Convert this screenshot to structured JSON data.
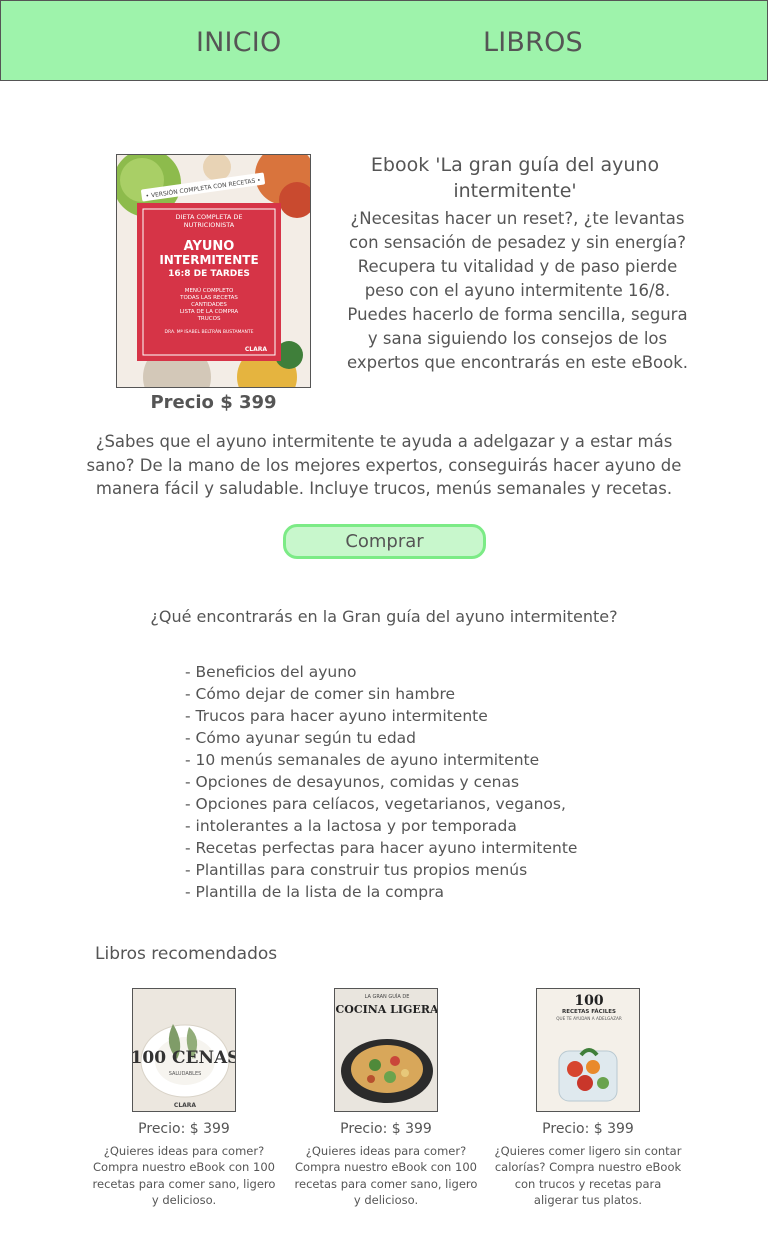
{
  "nav": {
    "inicio": "INICIO",
    "libros": "LIBROS"
  },
  "hero": {
    "cover": {
      "badge": "• VERSIÓN COMPLETA CON RECETAS •",
      "line1": "DIETA COMPLETA DE",
      "line2": "NUTRICIONISTA",
      "title1": "AYUNO",
      "title2": "INTERMITENTE",
      "title3": "16:8 DE TARDES",
      "items": [
        "MENÚ COMPLETO",
        "TODAS LAS RECETAS",
        "CANTIDADES",
        "LISTA DE LA COMPRA",
        "TRUCOS"
      ],
      "author": "DRA. Mª ISABEL BELTRÁN BUSTAMANTE",
      "publisher": "CLARA"
    },
    "price": "Precio $ 399",
    "title": "Ebook 'La gran guía del ayuno intermitente'",
    "description": "¿Necesitas hacer un reset?, ¿te levantas con sensación de pesadez y sin energía? Recupera tu vitalidad y de paso pierde peso con el ayuno intermitente 16/8. Puedes hacerlo de forma sencilla, segura y sana siguiendo los consejos de los expertos que encontrarás en este eBook."
  },
  "intro": "¿Sabes que el ayuno intermitente te ayuda a adelgazar y a estar más sano? De la mano de los mejores expertos, conseguirás hacer ayuno de manera fácil y saludable. Incluye trucos, menús semanales y recetas.",
  "buy_button": "Comprar",
  "features_title": "¿Qué encontrarás en la Gran guía del ayuno intermitente?",
  "features": [
    "- Beneficios del ayuno",
    "- Cómo dejar de comer sin hambre",
    "- Trucos para hacer ayuno intermitente",
    "- Cómo ayunar según tu edad",
    "- 10 menús semanales de ayuno intermitente",
    "- Opciones de desayunos, comidas y cenas",
    "- Opciones para celíacos, vegetarianos, veganos,",
    "- intolerantes a la lactosa y por temporada",
    "- Recetas perfectas para hacer ayuno intermitente",
    "- Plantillas para construir tus propios menús",
    "- Plantilla de la lista de la compra"
  ],
  "recommended_title": "Libros recomendados",
  "recommended": [
    {
      "cover_text": "100 CENAS",
      "cover_sub": "SALUDABLES",
      "cover_publisher": "CLARA",
      "price": "Precio: $ 399",
      "description": "¿Quieres ideas para comer? Compra nuestro eBook con 100 recetas para comer sano, ligero y delicioso."
    },
    {
      "cover_text": "COCINA LIGERA",
      "cover_sub": "LA GRAN GUÍA DE",
      "price": "Precio: $ 399",
      "description": "¿Quieres ideas para comer? Compra nuestro eBook con 100 recetas para comer sano, ligero y delicioso."
    },
    {
      "cover_text": "100",
      "cover_sub": "RECETAS FÁCILES",
      "cover_sub2": "QUE TE AYUDAN A ADELGAZAR",
      "price": "Precio: $ 399",
      "description": "¿Quieres comer ligero sin contar calorías? Compra nuestro eBook con trucos y recetas para aligerar tus platos."
    }
  ],
  "colors": {
    "nav_bg": "#9ef3ab",
    "button_bg": "#c8f7cc",
    "button_border": "#7ceb86",
    "cover_red": "#d63447",
    "text": "#555555"
  }
}
